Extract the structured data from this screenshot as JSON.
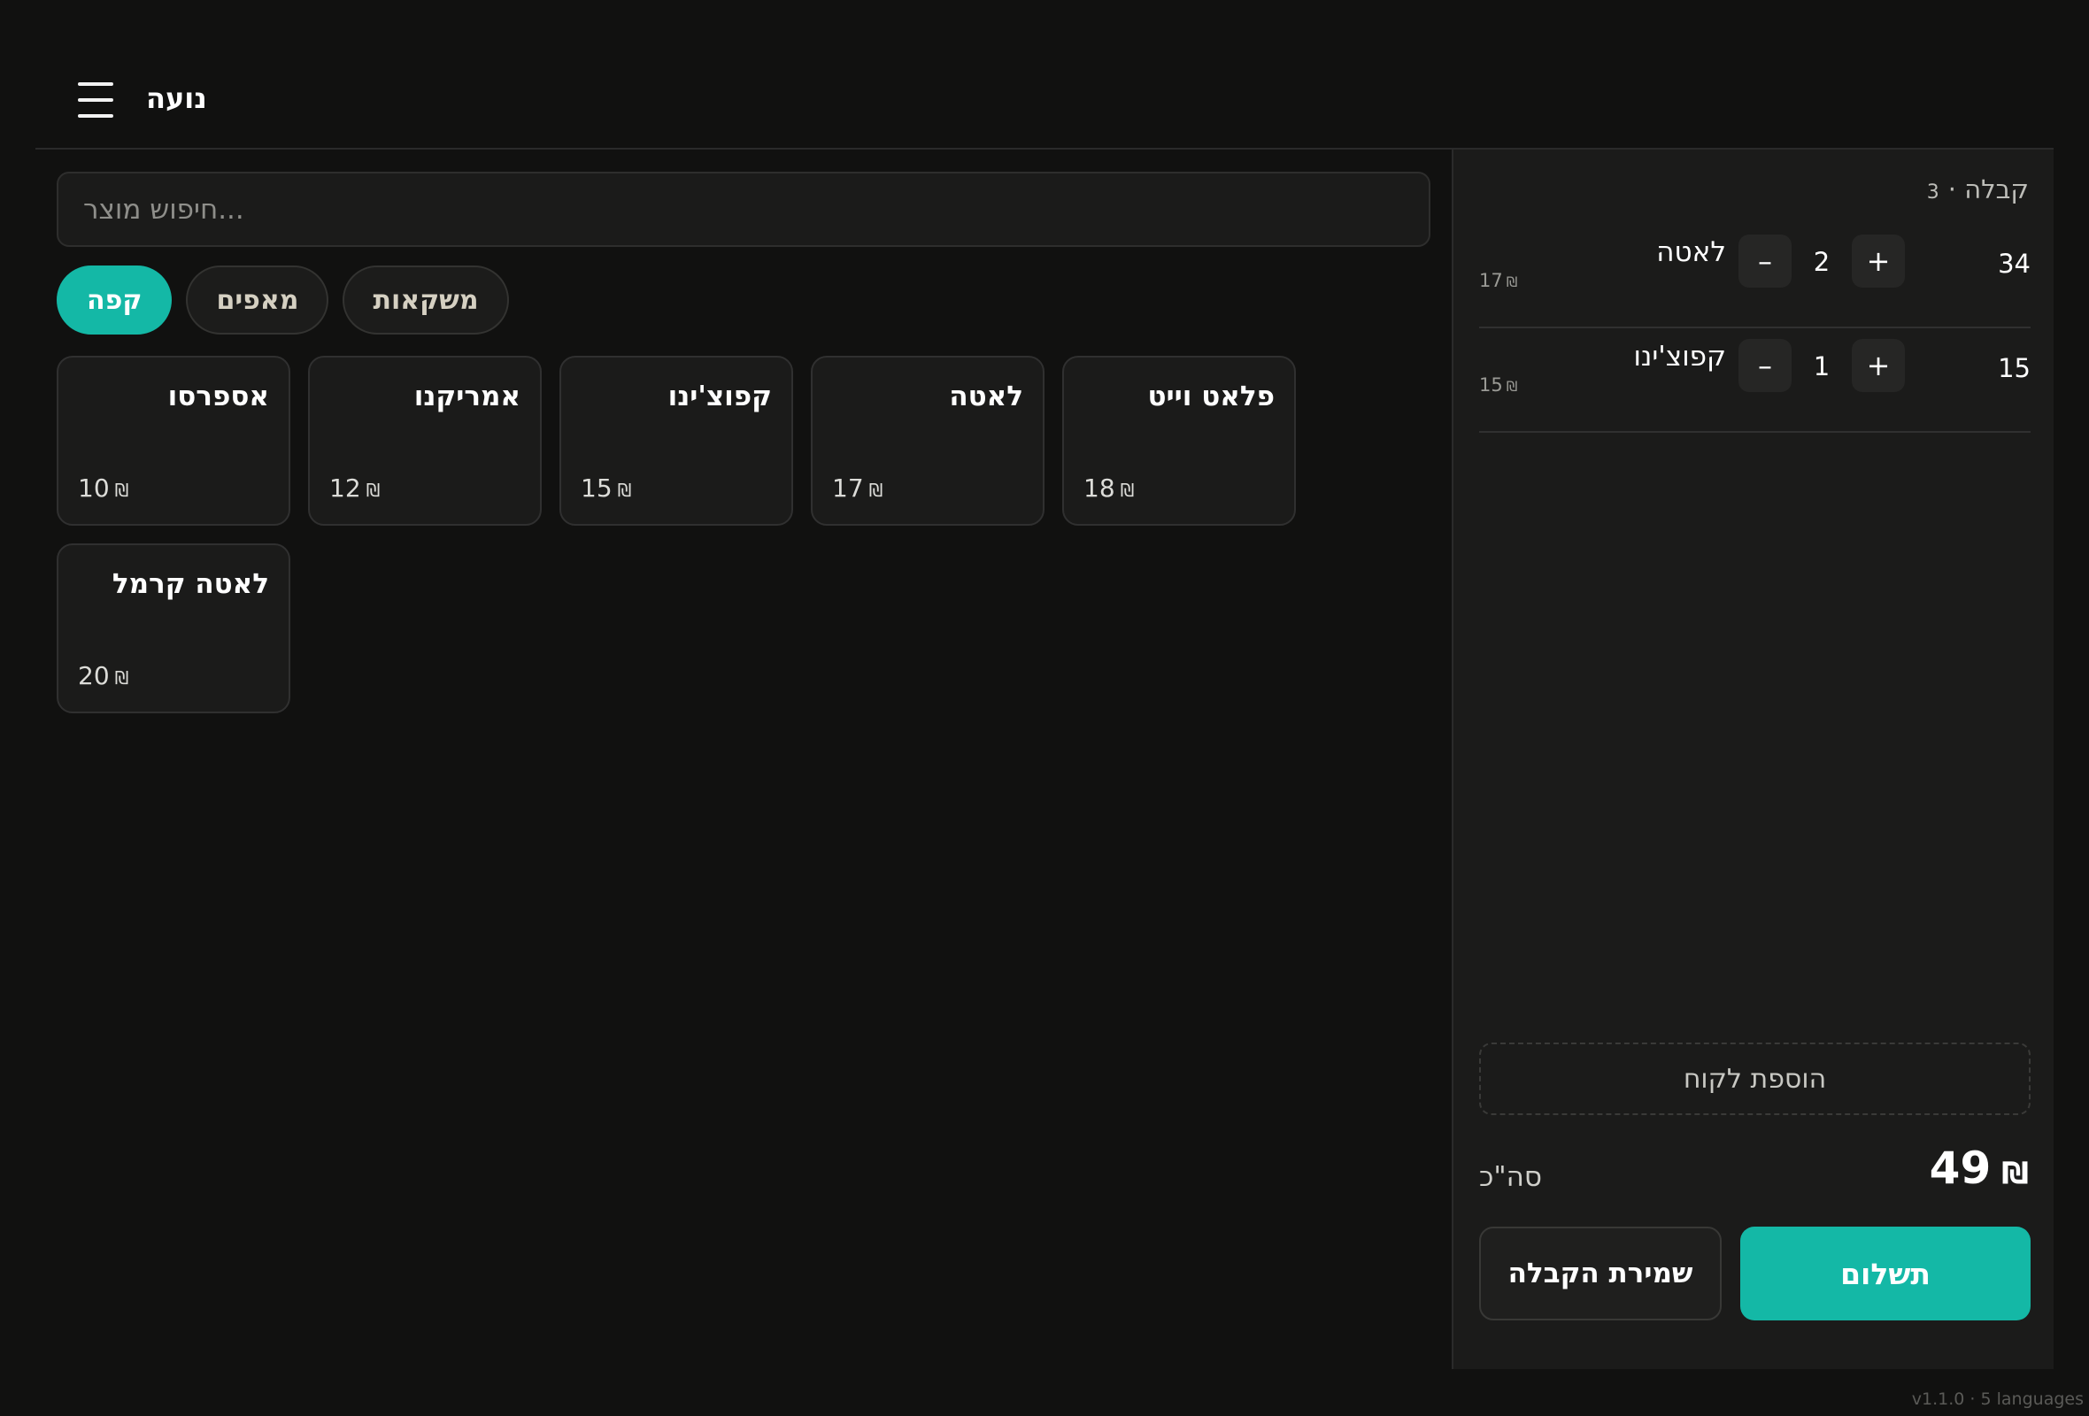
{
  "header": {
    "menu_icon": "hamburger-menu-icon",
    "user_name": "נועה"
  },
  "search": {
    "placeholder": "...חיפוש מוצר",
    "value": ""
  },
  "categories": [
    {
      "label": "קפה",
      "active": true
    },
    {
      "label": "מאפים",
      "active": false
    },
    {
      "label": "משקאות",
      "active": false
    }
  ],
  "products": [
    {
      "name": "אספרסו",
      "price": "10"
    },
    {
      "name": "אמריקנו",
      "price": "12"
    },
    {
      "name": "קפוצ'ינו",
      "price": "15"
    },
    {
      "name": "לאטה",
      "price": "17"
    },
    {
      "name": "פלאט וייט",
      "price": "18"
    },
    {
      "name": "לאטה קרמל",
      "price": "20"
    }
  ],
  "currency_symbol": "₪",
  "receipt": {
    "title": "קבלה ·",
    "number": "3",
    "items": [
      {
        "name": "לאטה",
        "unit_price": "17",
        "qty": "2",
        "total": "34"
      },
      {
        "name": "קפוצ'ינו",
        "unit_price": "15",
        "qty": "1",
        "total": "15"
      }
    ],
    "plus_label": "+",
    "minus_label": "–",
    "add_customer_label": "הוספת לקוח",
    "total_label": "סה\"כ",
    "total_value": "49",
    "save_label": "שמירת הקבלה",
    "pay_label": "תשלום"
  },
  "footer": {
    "version": "v1.1.0 · 5 languages"
  },
  "colors": {
    "accent": "#14b8a6",
    "background": "#111110",
    "panel": "#1b1b1a"
  }
}
